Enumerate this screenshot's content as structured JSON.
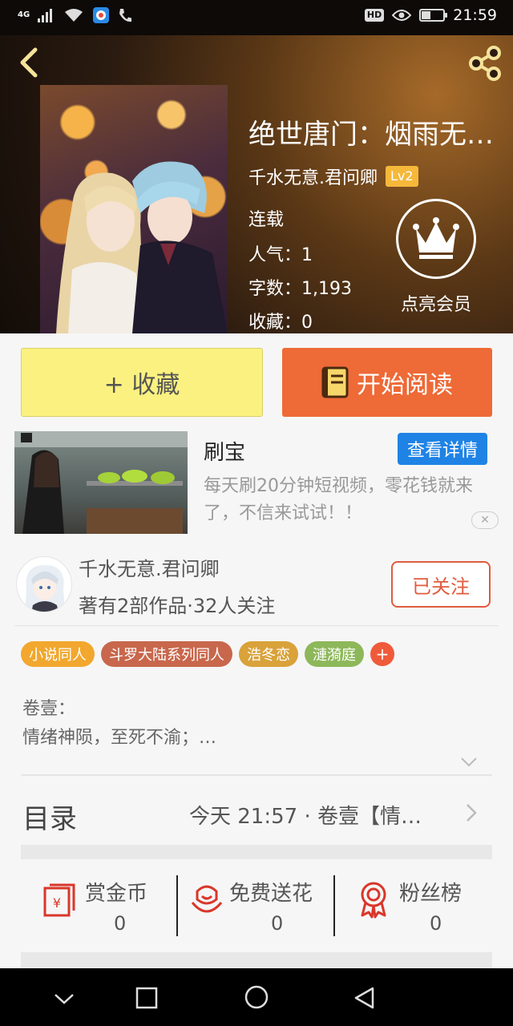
{
  "status_bar": {
    "network": "4G",
    "hd": "HD",
    "battery_level": 0.4,
    "time": "21:59"
  },
  "header": {
    "title": "绝世唐门：烟雨无…",
    "author": "千水无意.君问卿",
    "level": "Lv2",
    "status": "连载",
    "popularity": "人气：1",
    "word_count": "字数：1,193",
    "favorites": "收藏：0",
    "vip_label": "点亮会员"
  },
  "actions": {
    "collect_label": "+ 收藏",
    "read_label": "开始阅读"
  },
  "ad": {
    "title": "刷宝",
    "detail_label": "查看详情",
    "description": "每天刷20分钟短视频，零花钱就来了，不信来试试！！",
    "close_label": "✕"
  },
  "author_section": {
    "name": "千水无意.君问卿",
    "summary": "著有2部作品·32人关注",
    "follow_label": "已关注"
  },
  "tags": [
    {
      "label": "小说同人",
      "color": "#f2a72e"
    },
    {
      "label": "斗罗大陆系列同人",
      "color": "#c8674c"
    },
    {
      "label": "浩冬恋",
      "color": "#d9a23a"
    },
    {
      "label": "漣漪庭",
      "color": "#8db85a"
    }
  ],
  "tag_add_label": "+",
  "intro": {
    "line1": "卷壹：",
    "line2": "情绪神陨，至死不渝；…"
  },
  "toc": {
    "label": "目录",
    "latest": "今天 21:57 · 卷壹【情…"
  },
  "stats": {
    "reward": {
      "label": "赏金币",
      "count": "0"
    },
    "flowers": {
      "label": "免费送花",
      "count": "0"
    },
    "fans": {
      "label": "粉丝榜",
      "count": "0"
    }
  },
  "colors": {
    "accent_orange": "#ee6a37",
    "collect_yellow": "#fbf180",
    "follow_red": "#e05b3e",
    "ad_blue": "#1f83e5",
    "icon_red": "#d9372a"
  }
}
